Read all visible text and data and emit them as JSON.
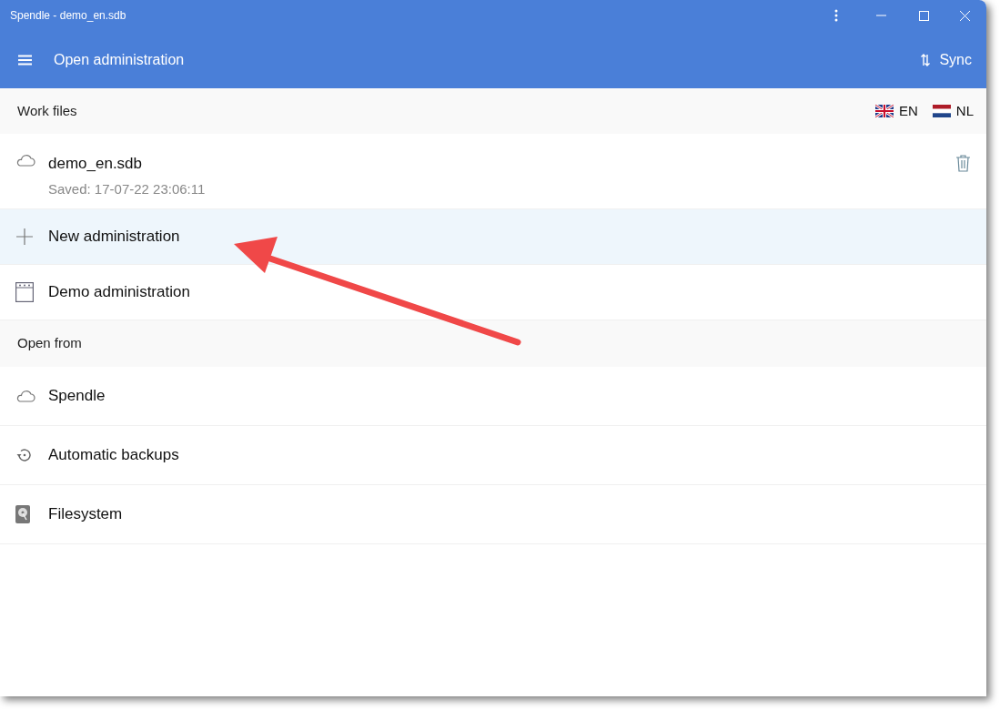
{
  "window": {
    "title": "Spendle - demo_en.sdb"
  },
  "app_bar": {
    "title": "Open administration",
    "sync": "Sync"
  },
  "work_files": {
    "heading": "Work files",
    "languages": [
      {
        "kind": "uk",
        "code": "EN"
      },
      {
        "kind": "nl",
        "code": "NL"
      }
    ],
    "items": [
      {
        "kind": "cloud-file",
        "name": "demo_en.sdb",
        "subtitle": "Saved: 17-07-22 23:06:11",
        "highlighted": false
      },
      {
        "kind": "new",
        "name": "New administration",
        "highlighted": true
      },
      {
        "kind": "demo",
        "name": "Demo administration",
        "highlighted": false
      }
    ]
  },
  "open_from": {
    "heading": "Open from",
    "items": [
      {
        "kind": "cloud",
        "name": "Spendle"
      },
      {
        "kind": "backups",
        "name": "Automatic backups"
      },
      {
        "kind": "filesystem",
        "name": "Filesystem"
      }
    ]
  }
}
